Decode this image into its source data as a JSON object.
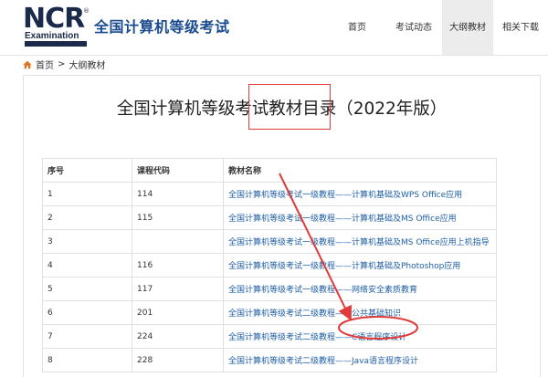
{
  "header": {
    "logo": {
      "mark": "NCR",
      "reg": "®",
      "sub": "Examination"
    },
    "site_title": "全国计算机等级考试",
    "nav": [
      {
        "label": "首页",
        "active": false
      },
      {
        "label": "考试动态",
        "active": false
      },
      {
        "label": "大纲教材",
        "active": true
      },
      {
        "label": "相关下载",
        "active": false
      }
    ]
  },
  "breadcrumb": {
    "home": "首页",
    "separator": ">",
    "current": "大纲教材"
  },
  "page": {
    "title": "全国计算机等级考试教材目录（2022年版）",
    "table": {
      "headers": [
        "序号",
        "课程代码",
        "教材名称"
      ],
      "rows": [
        [
          "1",
          "114",
          "全国计算机等级考试一级教程——计算机基础及WPS Office应用"
        ],
        [
          "2",
          "115",
          "全国计算机等级考试一级教程——计算机基础及MS Office应用"
        ],
        [
          "3",
          "",
          "全国计算机等级考试一级教程——计算机基础及MS Office应用上机指导"
        ],
        [
          "4",
          "116",
          "全国计算机等级考试一级教程——计算机基础及Photoshop应用"
        ],
        [
          "5",
          "117",
          "全国计算机等级考试一级教程——网络安全素质教育"
        ],
        [
          "6",
          "201",
          "全国计算机等级考试二级教程——公共基础知识"
        ],
        [
          "7",
          "224",
          "全国计算机等级考试二级教程——C语言程序设计"
        ],
        [
          "8",
          "228",
          "全国计算机等级考试二级教程——Java语言程序设计"
        ]
      ]
    }
  },
  "colors": {
    "brand": "#1b4b8f",
    "link": "#1f5fa6",
    "annotation": "#e03a3a",
    "nav_active_bg": "#ececec"
  }
}
